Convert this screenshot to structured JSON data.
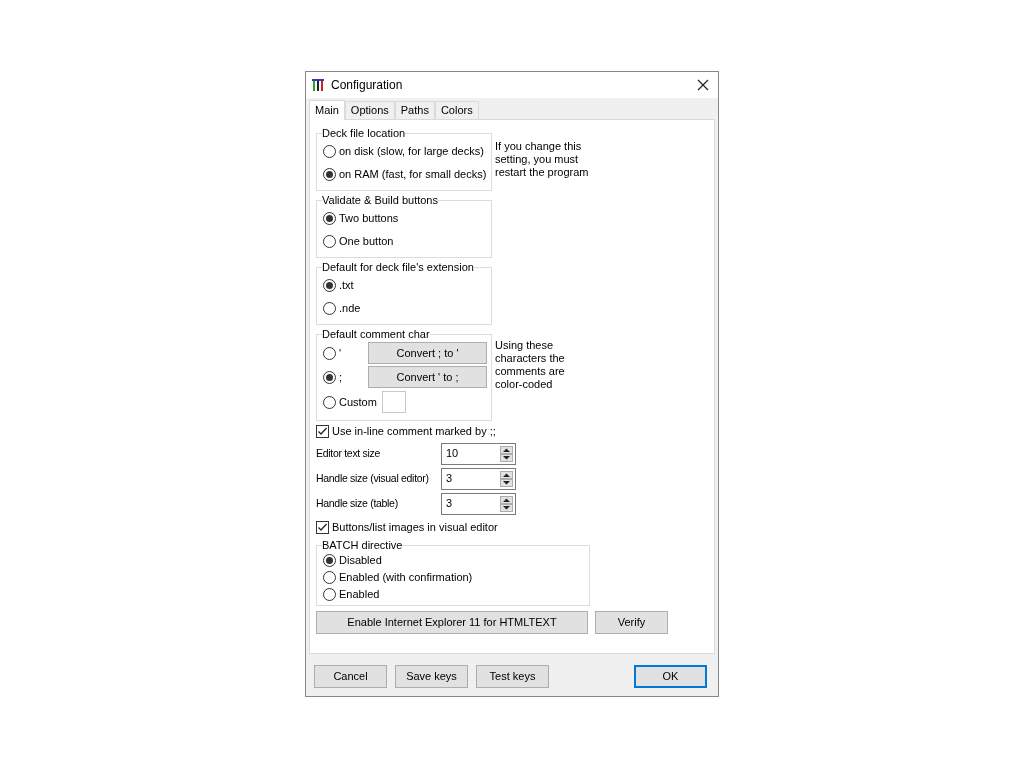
{
  "window": {
    "title": "Configuration"
  },
  "tabs": [
    {
      "label": "Main",
      "selected": true
    },
    {
      "label": "Options",
      "selected": false
    },
    {
      "label": "Paths",
      "selected": false
    },
    {
      "label": "Colors",
      "selected": false
    }
  ],
  "deck_file_location": {
    "legend": "Deck file location",
    "options": [
      {
        "label": "on disk (slow, for large decks)",
        "selected": false
      },
      {
        "label": "on RAM (fast, for small decks)",
        "selected": true
      }
    ],
    "note": "If you change this setting, you must restart the program"
  },
  "validate_build_buttons": {
    "legend": "Validate & Build buttons",
    "options": [
      {
        "label": "Two buttons",
        "selected": true
      },
      {
        "label": "One button",
        "selected": false
      }
    ]
  },
  "default_extension": {
    "legend": "Default for deck file's extension",
    "options": [
      {
        "label": ".txt",
        "selected": true
      },
      {
        "label": ".nde",
        "selected": false
      }
    ]
  },
  "default_comment_char": {
    "legend": "Default comment char",
    "options": [
      {
        "label": "'",
        "selected": false,
        "kind": "button",
        "button": "Convert ; to '"
      },
      {
        "label": ";",
        "selected": true,
        "kind": "button",
        "button": "Convert ' to ;"
      },
      {
        "label": "Custom",
        "selected": false,
        "kind": "field"
      }
    ],
    "note": "Using these characters the comments are color-coded"
  },
  "inline_comment": {
    "label": "Use in-line comment marked by ;;",
    "checked": true
  },
  "spinners": [
    {
      "label": "Editor text size",
      "value": "10"
    },
    {
      "label": "Handle size (visual editor)",
      "value": "3"
    },
    {
      "label": "Handle size (table)",
      "value": "3"
    }
  ],
  "images_checkbox": {
    "label": "Buttons/list images in visual editor",
    "checked": true
  },
  "batch_directive": {
    "legend": "BATCH directive",
    "options": [
      {
        "label": "Disabled",
        "selected": true
      },
      {
        "label": "Enabled (with confirmation)",
        "selected": false
      },
      {
        "label": "Enabled",
        "selected": false
      }
    ]
  },
  "action_buttons": [
    "Enable Internet Explorer 11 for HTMLTEXT",
    "Verify"
  ],
  "footer_buttons": [
    {
      "label": "Cancel",
      "default": false
    },
    {
      "label": "Save keys",
      "default": false
    },
    {
      "label": "Test keys",
      "default": false
    },
    {
      "label": "OK",
      "default": true
    }
  ]
}
